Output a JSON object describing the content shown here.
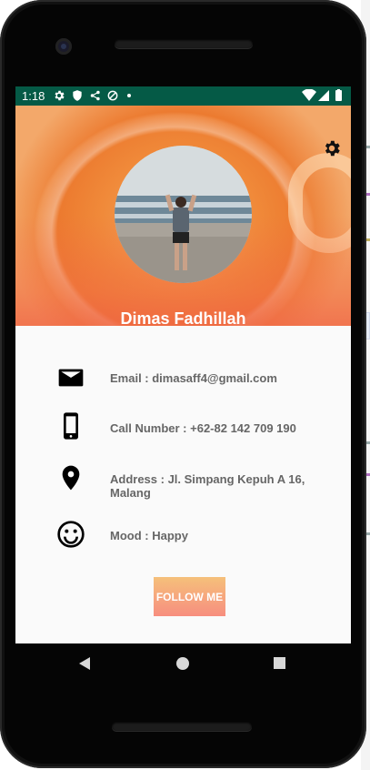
{
  "status_bar": {
    "time": "1:18",
    "left_icons": [
      "gear-icon",
      "shield-icon",
      "share-icon",
      "sync-icon",
      "dot-icon"
    ],
    "right_icons": [
      "wifi-icon",
      "signal-icon",
      "battery-icon"
    ]
  },
  "profile": {
    "name": "Dimas Fadhillah",
    "settings_icon": "gear-icon"
  },
  "info": {
    "email": "Email : dimasaff4@gmail.com",
    "phone": "Call Number : +62-82 142 709 190",
    "address": "Address : Jl. Simpang Kepuh A 16, Malang",
    "mood": "Mood : Happy"
  },
  "icons": {
    "email": "email-icon",
    "phone": "phone-icon",
    "address": "location-pin-icon",
    "mood": "smiley-icon"
  },
  "follow_button": {
    "label": "FOLLOW ME"
  },
  "nav_bar": {
    "items": [
      "back-icon",
      "home-icon",
      "recent-apps-icon"
    ]
  },
  "colors": {
    "status_bar": "#055a46",
    "button_gradient_top": "#f5c07a",
    "button_gradient_bottom": "#f78e7e",
    "info_text": "#666666"
  }
}
